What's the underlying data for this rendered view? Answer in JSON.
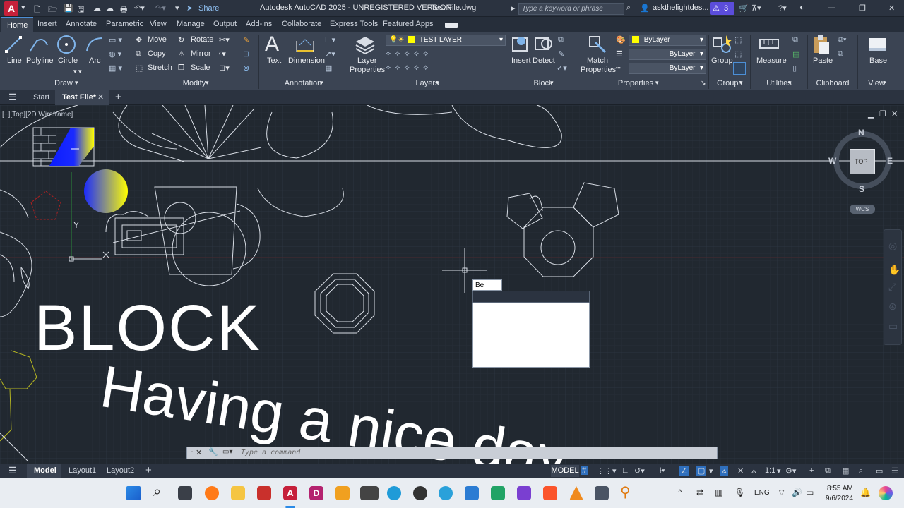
{
  "titlebar": {
    "title": "Autodesk AutoCAD 2025 - UNREGISTERED VERSION",
    "file": "Test File.dwg",
    "share": "Share",
    "search_placeholder": "Type a keyword or phrase",
    "user": "askthelightdes...",
    "alerts": "3"
  },
  "ribbon_tabs": [
    "Home",
    "Insert",
    "Annotate",
    "Parametric",
    "View",
    "Manage",
    "Output",
    "Add-ins",
    "Collaborate",
    "Express Tools",
    "Featured Apps"
  ],
  "draw": {
    "line": "Line",
    "polyline": "Polyline",
    "circle": "Circle",
    "arc": "Arc",
    "title": "Draw"
  },
  "modify": {
    "move": "Move",
    "rotate": "Rotate",
    "copy": "Copy",
    "mirror": "Mirror",
    "stretch": "Stretch",
    "scale": "Scale",
    "title": "Modify"
  },
  "annotation": {
    "text": "Text",
    "dimension": "Dimension",
    "title": "Annotation"
  },
  "layers": {
    "properties1": "Layer",
    "properties2": "Properties",
    "current": "TEST LAYER",
    "title": "Layers"
  },
  "block": {
    "insert": "Insert",
    "detect": "Detect",
    "title": "Block"
  },
  "properties": {
    "match1": "Match",
    "match2": "Properties",
    "color": "ByLayer",
    "linetype": "ByLayer",
    "lineweight": "ByLayer",
    "title": "Properties"
  },
  "groups": {
    "group": "Group",
    "title": "Groups"
  },
  "utilities": {
    "measure": "Measure",
    "title": "Utilities"
  },
  "clipboard": {
    "paste": "Paste",
    "title": "Clipboard"
  },
  "view": {
    "base": "Base",
    "title": "View"
  },
  "filetabs": {
    "start": "Start",
    "current": "Test File*"
  },
  "viewport": {
    "label": "[−][Top][2D Wireframe]"
  },
  "viewcube": {
    "n": "N",
    "s": "S",
    "e": "E",
    "w": "W",
    "top": "TOP",
    "wcs": "WCS"
  },
  "drawing_text": {
    "block": "BLOCK",
    "nice": "Having a nice day"
  },
  "ucs": {
    "y": "Y"
  },
  "input": {
    "value": "Be"
  },
  "command": {
    "placeholder": "Type a command"
  },
  "layouts": [
    "Model",
    "Layout1",
    "Layout2"
  ],
  "status": {
    "model": "MODEL",
    "scale": "1:1"
  },
  "tray": {
    "lang": "ENG",
    "time": "8:55 AM",
    "date": "9/6/2024"
  },
  "colors": {
    "accent": "#4c8fd6",
    "layer_yellow": "#ffff00",
    "canvas": "#212830",
    "ribbon": "#3b4453"
  }
}
